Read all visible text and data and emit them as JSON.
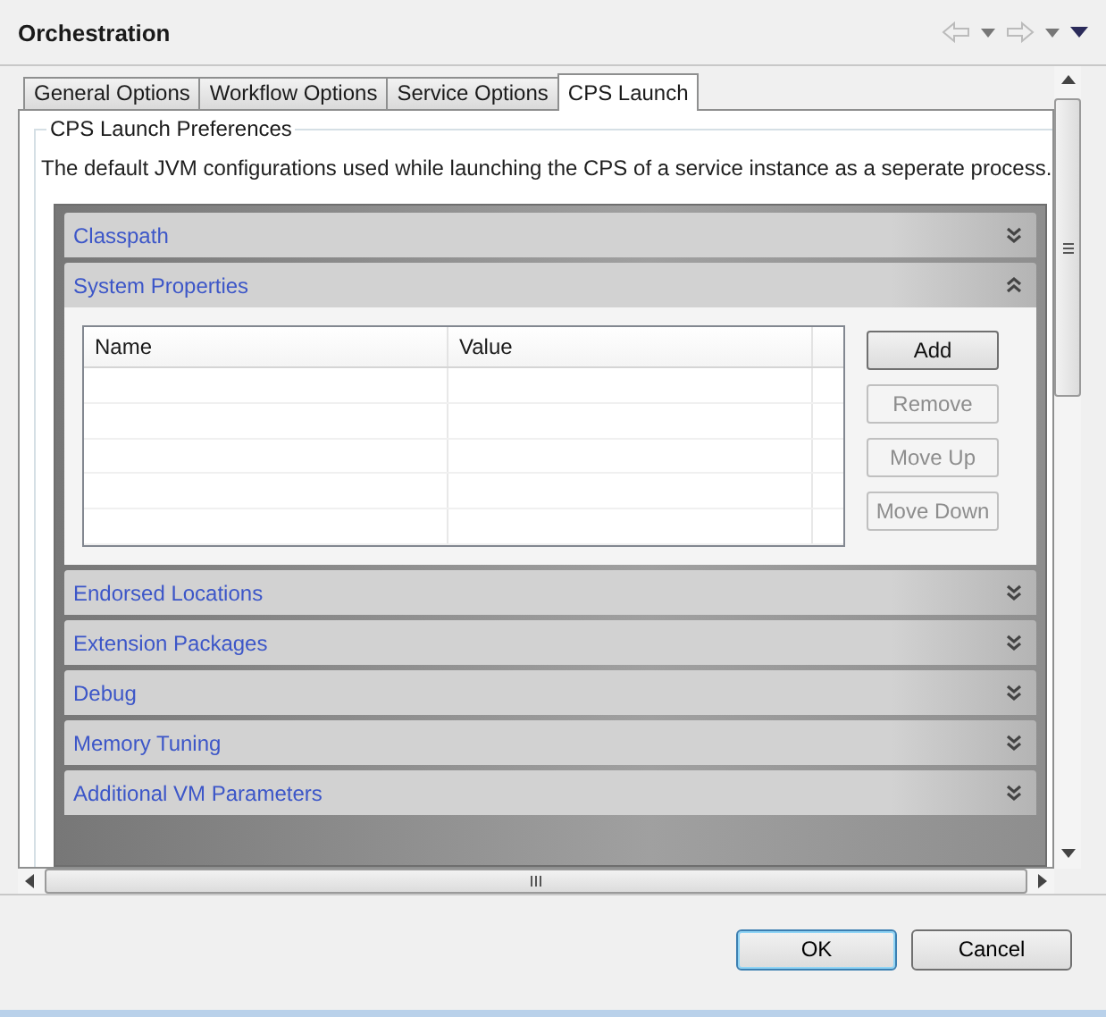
{
  "window": {
    "title": "Orchestration"
  },
  "tabs": [
    {
      "label": "General Options",
      "selected": false
    },
    {
      "label": "Workflow Options",
      "selected": false
    },
    {
      "label": "Service Options",
      "selected": false
    },
    {
      "label": "CPS Launch",
      "selected": true
    }
  ],
  "group": {
    "title": "CPS Launch Preferences",
    "description": "The default JVM configurations used while launching the CPS of a service instance as a seperate process."
  },
  "sections": [
    {
      "title": "Classpath",
      "expanded": false
    },
    {
      "title": "System Properties",
      "expanded": true,
      "table": {
        "columns": [
          "Name",
          "Value"
        ]
      },
      "buttons": [
        {
          "label": "Add",
          "disabled": false
        },
        {
          "label": "Remove",
          "disabled": true
        },
        {
          "label": "Move Up",
          "disabled": true
        },
        {
          "label": "Move Down",
          "disabled": true
        }
      ]
    },
    {
      "title": "Endorsed Locations",
      "expanded": false
    },
    {
      "title": "Extension Packages",
      "expanded": false
    },
    {
      "title": "Debug",
      "expanded": false
    },
    {
      "title": "Memory Tuning",
      "expanded": false
    },
    {
      "title": "Additional VM Parameters",
      "expanded": false
    }
  ],
  "buttons": [
    {
      "label": "OK",
      "default": true
    },
    {
      "label": "Cancel",
      "default": false
    }
  ]
}
